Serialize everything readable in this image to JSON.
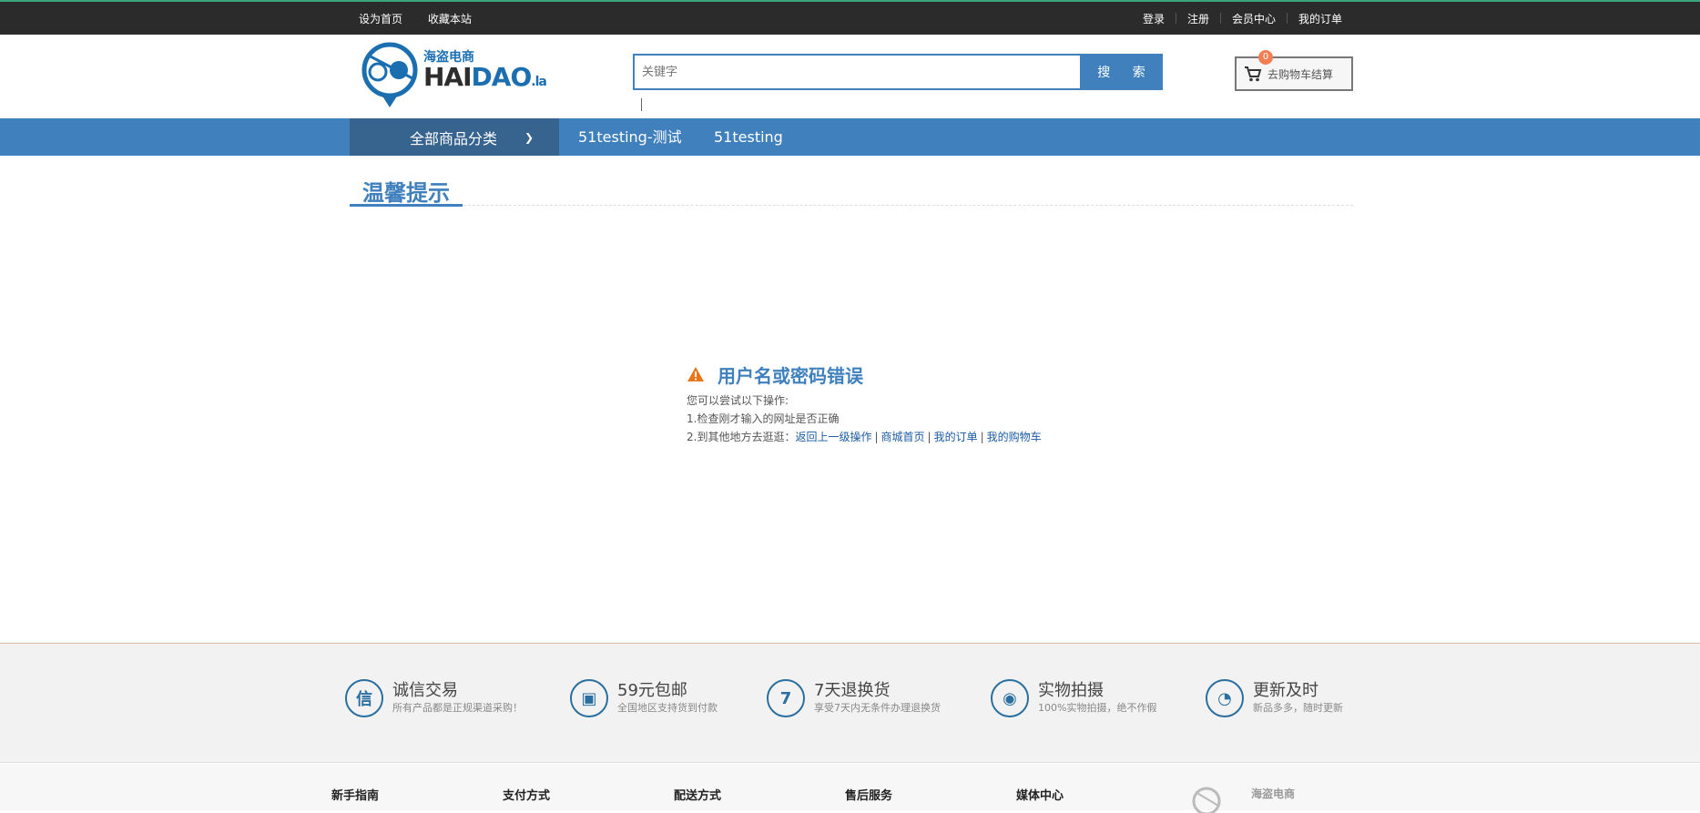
{
  "topbar": {
    "left": [
      "设为首页",
      "收藏本站"
    ],
    "right": [
      "登录",
      "注册",
      "会员中心",
      "我的订单"
    ]
  },
  "header": {
    "logo_cn": "海盗电商",
    "logo_en_a": "HAI",
    "logo_en_b": "DAO",
    "logo_en_suffix": ".la",
    "search_placeholder": "关键字",
    "search_button": "搜 索",
    "cart_count": "0",
    "cart_label": "去购物车结算"
  },
  "nav": {
    "category_label": "全部商品分类",
    "links": [
      "51testing-测试",
      "51testing"
    ]
  },
  "tip": {
    "title": "温馨提示",
    "message": "用户名或密码错误",
    "line1": "您可以尝试以下操作:",
    "line2": "1.检查刚才输入的网址是否正确",
    "line3_prefix": "2.到其他地方去逛逛：",
    "links": [
      "返回上一级操作",
      "商城首页",
      "我的订单",
      "我的购物车"
    ]
  },
  "services": [
    {
      "icon": "shield-icon",
      "glyph": "信",
      "title": "诚信交易",
      "desc": "所有产品都是正规渠道采购！"
    },
    {
      "icon": "truck-icon",
      "glyph": "▣",
      "title": "59元包邮",
      "desc": "全国地区支持货到付款"
    },
    {
      "icon": "seven-icon",
      "glyph": "7",
      "title": "7天退换货",
      "desc": "享受7天内无条件办理退换货"
    },
    {
      "icon": "camera-icon",
      "glyph": "◉",
      "title": "实物拍摄",
      "desc": "100%实物拍摄，绝不作假"
    },
    {
      "icon": "clock-icon",
      "glyph": "◔",
      "title": "更新及时",
      "desc": "新品多多，随时更新"
    }
  ],
  "footer": {
    "columns": [
      "新手指南",
      "支付方式",
      "配送方式",
      "售后服务",
      "媒体中心"
    ],
    "logo_cn": "海盗电商"
  },
  "colors": {
    "accent": "#3f80bd",
    "nav_dark": "#37648e",
    "topbar": "#2b2b2b",
    "warning": "#e8761c"
  }
}
